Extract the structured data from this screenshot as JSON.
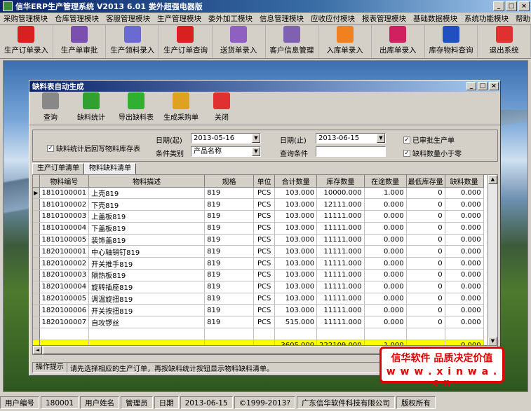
{
  "app": {
    "title": "信华ERP生产管理系统  V2013 6.01 娄外超强电器版"
  },
  "menu": [
    "采购管理模块",
    "仓库管理模块",
    "客服管理模块",
    "生产管理模块",
    "委外加工模块",
    "信息管理模块",
    "应收应付模块",
    "报表管理模块",
    "基础数据模块",
    "系统功能模块",
    "帮助"
  ],
  "toolbar": [
    {
      "label": "生产订单录入",
      "icon": "pdf-document-icon",
      "color": "#d82020"
    },
    {
      "label": "生产单审批",
      "icon": "approve-icon",
      "color": "#7a4fb0"
    },
    {
      "label": "生产领料录入",
      "icon": "material-issue-icon",
      "color": "#6a6ad0"
    },
    {
      "label": "生产订单查询",
      "icon": "order-query-icon",
      "color": "#d82020"
    },
    {
      "label": "送货单录入",
      "icon": "delivery-icon",
      "color": "#9060c0"
    },
    {
      "label": "客户信息管理",
      "icon": "customer-icon",
      "color": "#8060b0"
    },
    {
      "label": "入库单录入",
      "icon": "stock-in-icon",
      "color": "#f08020"
    },
    {
      "label": "出库单录入",
      "icon": "stock-out-icon",
      "color": "#d02060"
    },
    {
      "label": "库存物料查询",
      "icon": "inventory-icon",
      "color": "#2050c0"
    },
    {
      "label": "退出系统",
      "icon": "exit-icon",
      "color": "#e03030"
    }
  ],
  "dialog": {
    "title": "缺料表自动生成",
    "toolbar": [
      {
        "label": "查询",
        "icon": "search-icon",
        "color": "#888888"
      },
      {
        "label": "缺料统计",
        "icon": "refresh-icon",
        "color": "#30a030"
      },
      {
        "label": "导出缺料表",
        "icon": "export-arrow-icon",
        "color": "#30b030"
      },
      {
        "label": "生成采购单",
        "icon": "purchase-icon",
        "color": "#e0a020"
      },
      {
        "label": "关闭",
        "icon": "close-power-icon",
        "color": "#e03030"
      }
    ],
    "filters": {
      "writeback_label": "缺料统计后回写物料库存表",
      "date_from_label": "日期(起)",
      "date_from": "2013-05-16",
      "date_to_label": "日期(止)",
      "date_to": "2013-06-15",
      "approved_label": "已审批生产单",
      "condition_type_label": "条件类别",
      "condition_type": "产品名称",
      "query_label": "查询条件",
      "query_value": "",
      "shortage_label": "缺料数量小于零"
    },
    "tabs": [
      "生产订单清单",
      "物料缺料清单"
    ],
    "grid": {
      "columns": [
        "物料编号",
        "物料描述",
        "规格",
        "单位",
        "合计数量",
        "库存数量",
        "在途数量",
        "最低库存量",
        "缺料数量"
      ],
      "rows": [
        [
          "1810100001",
          "上壳819",
          "819",
          "PCS",
          "103.000",
          "10000.000",
          "1.000",
          "0",
          "0.000"
        ],
        [
          "1810100002",
          "下壳819",
          "819",
          "PCS",
          "103.000",
          "12111.000",
          "0.000",
          "0",
          "0.000"
        ],
        [
          "1810100003",
          "上盖板819",
          "819",
          "PCS",
          "103.000",
          "11111.000",
          "0.000",
          "0",
          "0.000"
        ],
        [
          "1810100004",
          "下盖板819",
          "819",
          "PCS",
          "103.000",
          "11111.000",
          "0.000",
          "0",
          "0.000"
        ],
        [
          "1810100005",
          "装饰盖819",
          "819",
          "PCS",
          "103.000",
          "11111.000",
          "0.000",
          "0",
          "0.000"
        ],
        [
          "1820100001",
          "中心轴销钉819",
          "819",
          "PCS",
          "103.000",
          "11111.000",
          "0.000",
          "0",
          "0.000"
        ],
        [
          "1820100002",
          "开关推手819",
          "819",
          "PCS",
          "103.000",
          "11111.000",
          "0.000",
          "0",
          "0.000"
        ],
        [
          "1820100003",
          "隔热板819",
          "819",
          "PCS",
          "103.000",
          "11111.000",
          "0.000",
          "0",
          "0.000"
        ],
        [
          "1820100004",
          "旋转插座819",
          "819",
          "PCS",
          "103.000",
          "11111.000",
          "0.000",
          "0",
          "0.000"
        ],
        [
          "1820100005",
          "调温旋扭819",
          "819",
          "PCS",
          "103.000",
          "11111.000",
          "0.000",
          "0",
          "0.000"
        ],
        [
          "1820100006",
          "开关按扭819",
          "819",
          "PCS",
          "103.000",
          "11111.000",
          "0.000",
          "0",
          "0.000"
        ],
        [
          "1820100007",
          "自攻锣丝",
          "819",
          "PCS",
          "515.000",
          "11111.000",
          "0.000",
          "0",
          "0.000"
        ]
      ],
      "totals": {
        "total_qty": "3605.000",
        "stock_qty": "222109.000",
        "transit_qty": "1.000",
        "shortage_qty": "0.000"
      }
    },
    "hint": {
      "label": "操作提示",
      "text": "请先选择相应的生产订单，再按缺料统计按钮显示物料缺料清单。"
    }
  },
  "brand": {
    "line1": "信华软件 品质决定价值",
    "line2": "w w w . x i n w a . c n"
  },
  "status": {
    "user_no_label": "用户编号",
    "user_no": "180001",
    "user_name_label": "用户姓名",
    "user_name": "管理员",
    "date_label": "日期",
    "date": "2013-06-15",
    "copyright": "©1999-2013?",
    "company": "广东信华软件科技有限公司",
    "rights": "版权所有"
  }
}
